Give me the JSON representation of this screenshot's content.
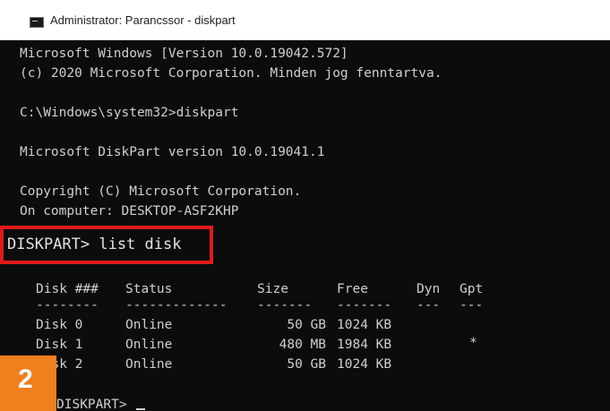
{
  "window": {
    "title": "Administrator: Parancssor - diskpart",
    "icon": "console-icon"
  },
  "console": {
    "lines": [
      "Microsoft Windows [Version 10.0.19042.572]",
      "(c) 2020 Microsoft Corporation. Minden jog fenntartva.",
      "",
      "C:\\Windows\\system32>diskpart",
      "",
      "Microsoft DiskPart version 10.0.19041.1",
      "",
      "Copyright (C) Microsoft Corporation.",
      "On computer: DESKTOP-ASF2KHP"
    ],
    "command_prompt": "DISKPART> list disk",
    "table": {
      "headers": [
        "Disk ###",
        "Status",
        "Size",
        "Free",
        "Dyn",
        "Gpt"
      ],
      "separators": [
        "--------",
        "-------------",
        "-------",
        "-------",
        "---",
        "---"
      ],
      "rows": [
        {
          "disk": "Disk 0",
          "status": "Online",
          "size": "50 GB",
          "free": "1024 KB",
          "dyn": "",
          "gpt": ""
        },
        {
          "disk": "Disk 1",
          "status": "Online",
          "size": "480 MB",
          "free": "1984 KB",
          "dyn": "",
          "gpt": "*"
        },
        {
          "disk": "Disk 2",
          "status": "Online",
          "size": "50 GB",
          "free": "1024 KB",
          "dyn": "",
          "gpt": ""
        }
      ]
    },
    "final_prompt": "DISKPART>"
  },
  "badge": {
    "step": "2",
    "color": "#f07f1e"
  },
  "highlight_color": "#e01a1a"
}
